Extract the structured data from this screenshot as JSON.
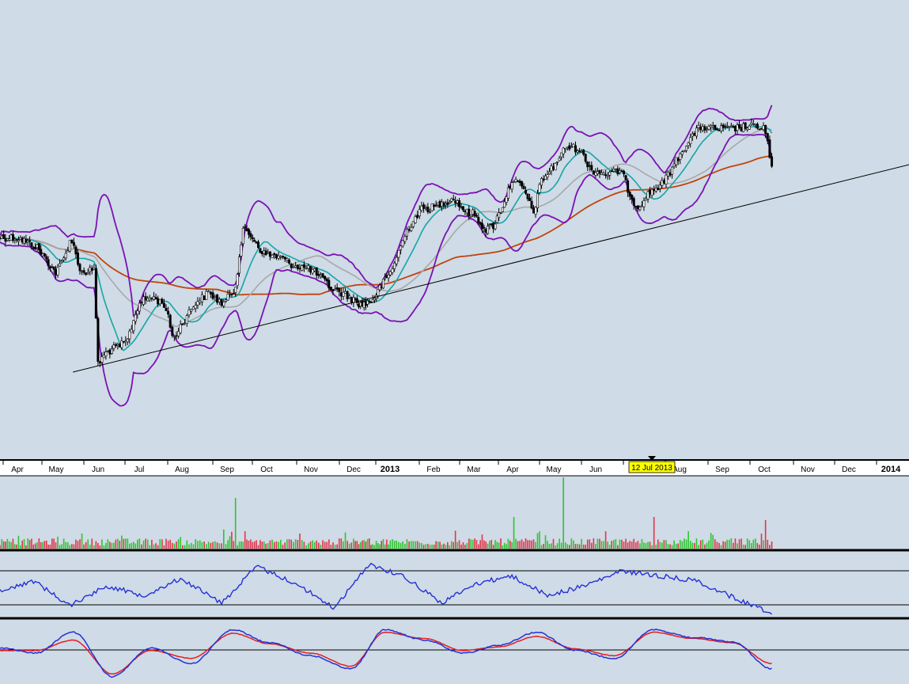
{
  "colors": {
    "background": "#cfdbe6",
    "candle": "#000000",
    "bollinger": "#7a12b5",
    "ema_fast": "#14a6a6",
    "ma_mid": "#a8a8a8",
    "ma_long": "#c0440e",
    "trendline": "#000000",
    "volume_up": "#2ec42e",
    "volume_down": "#e0354a",
    "rsi_line": "#2431d6",
    "macd_line": "#2431d6",
    "signal_line": "#e41e1e",
    "cursor_flag": "#ffff00"
  },
  "chart_data": [
    {
      "type": "candlestick",
      "panel": "price",
      "title": "",
      "overlays": [
        "bollinger-bands",
        "moving-average-fast",
        "moving-average-mid",
        "moving-average-long",
        "trendline"
      ],
      "x_axis": {
        "ticks": [
          "Apr",
          "May",
          "Jun",
          "Jul",
          "Aug",
          "Sep",
          "Oct",
          "Nov",
          "Dec",
          "2013",
          "Feb",
          "Mar",
          "Apr",
          "May",
          "Jun",
          "Jul",
          "Aug",
          "Sep",
          "Oct",
          "Nov",
          "Dec",
          "2014"
        ],
        "bold_ticks": [
          "2013",
          "2014"
        ],
        "cursor_label": "12 Jul 2013",
        "cursor_tick_index": 15
      },
      "price_anchors": [
        {
          "m": 0,
          "v": 300
        },
        {
          "m": 0.5,
          "v": 312
        },
        {
          "m": 1.0,
          "v": 345
        },
        {
          "m": 1.2,
          "v": 325
        },
        {
          "m": 1.35,
          "v": 300
        },
        {
          "m": 1.6,
          "v": 345
        },
        {
          "m": 1.9,
          "v": 340
        },
        {
          "m": 2.0,
          "v": 460
        },
        {
          "m": 2.2,
          "v": 445
        },
        {
          "m": 2.4,
          "v": 440
        },
        {
          "m": 2.7,
          "v": 432
        },
        {
          "m": 3.0,
          "v": 382
        },
        {
          "m": 3.3,
          "v": 375
        },
        {
          "m": 3.6,
          "v": 385
        },
        {
          "m": 3.8,
          "v": 428
        },
        {
          "m": 4.05,
          "v": 404
        },
        {
          "m": 4.3,
          "v": 382
        },
        {
          "m": 4.6,
          "v": 370
        },
        {
          "m": 4.9,
          "v": 384
        },
        {
          "m": 5.2,
          "v": 365
        },
        {
          "m": 5.4,
          "v": 290
        },
        {
          "m": 5.65,
          "v": 300
        },
        {
          "m": 5.9,
          "v": 320
        },
        {
          "m": 6.3,
          "v": 325
        },
        {
          "m": 6.6,
          "v": 335
        },
        {
          "m": 7.0,
          "v": 340
        },
        {
          "m": 7.5,
          "v": 365
        },
        {
          "m": 7.8,
          "v": 372
        },
        {
          "m": 8.2,
          "v": 385
        },
        {
          "m": 8.5,
          "v": 380
        },
        {
          "m": 8.8,
          "v": 358
        },
        {
          "m": 9.0,
          "v": 345
        },
        {
          "m": 9.4,
          "v": 290
        },
        {
          "m": 9.7,
          "v": 265
        },
        {
          "m": 10.0,
          "v": 262
        },
        {
          "m": 10.5,
          "v": 250
        },
        {
          "m": 10.8,
          "v": 268
        },
        {
          "m": 11.0,
          "v": 270
        },
        {
          "m": 11.3,
          "v": 290
        },
        {
          "m": 11.5,
          "v": 285
        },
        {
          "m": 11.7,
          "v": 265
        },
        {
          "m": 12.0,
          "v": 225
        },
        {
          "m": 12.3,
          "v": 242
        },
        {
          "m": 12.5,
          "v": 270
        },
        {
          "m": 12.7,
          "v": 228
        },
        {
          "m": 13.0,
          "v": 210
        },
        {
          "m": 13.3,
          "v": 185
        },
        {
          "m": 13.6,
          "v": 188
        },
        {
          "m": 13.9,
          "v": 215
        },
        {
          "m": 14.3,
          "v": 220
        },
        {
          "m": 14.6,
          "v": 215
        },
        {
          "m": 14.85,
          "v": 250
        },
        {
          "m": 15.0,
          "v": 262
        },
        {
          "m": 15.3,
          "v": 242
        },
        {
          "m": 15.6,
          "v": 232
        },
        {
          "m": 15.9,
          "v": 205
        },
        {
          "m": 16.2,
          "v": 178
        },
        {
          "m": 16.5,
          "v": 160
        },
        {
          "m": 16.8,
          "v": 163
        },
        {
          "m": 17.2,
          "v": 163
        },
        {
          "m": 17.6,
          "v": 160
        },
        {
          "m": 17.9,
          "v": 160
        },
        {
          "m": 18.0,
          "v": 162
        },
        {
          "m": 18.1,
          "v": 186
        },
        {
          "m": 18.2,
          "v": 225
        }
      ],
      "trendline": [
        {
          "m": 1.4,
          "v": 470
        },
        {
          "m": 22.5,
          "v": 208
        }
      ]
    },
    {
      "type": "bar",
      "panel": "volume",
      "title": "",
      "description": "daily volume bars, green on up days and red on down days"
    },
    {
      "type": "line",
      "panel": "oscillator",
      "title": "",
      "reference_lines": 2,
      "series": [
        {
          "values": [
            0.45,
            0.65,
            0.15,
            0.55,
            0.35,
            0.7,
            0.2,
            0.95,
            0.6,
            0.1,
            1.0,
            0.75,
            0.2,
            0.6,
            0.75,
            0.35,
            0.55,
            0.85,
            0.75,
            0.65,
            0.3,
            0.0
          ]
        }
      ]
    },
    {
      "type": "line",
      "panel": "macd",
      "title": "",
      "reference_lines": 1,
      "series": [
        {
          "values": [
            0.6,
            0.5,
            0.9,
            0.05,
            0.6,
            0.3,
            0.95,
            0.7,
            0.45,
            0.2,
            0.95,
            0.75,
            0.5,
            0.65,
            0.9,
            0.55,
            0.4,
            0.95,
            0.8,
            0.72,
            0.2
          ]
        },
        {
          "values": [
            0.55,
            0.55,
            0.75,
            0.1,
            0.55,
            0.4,
            0.88,
            0.68,
            0.5,
            0.25,
            0.9,
            0.78,
            0.55,
            0.62,
            0.82,
            0.58,
            0.45,
            0.9,
            0.78,
            0.7,
            0.3
          ]
        }
      ]
    }
  ]
}
